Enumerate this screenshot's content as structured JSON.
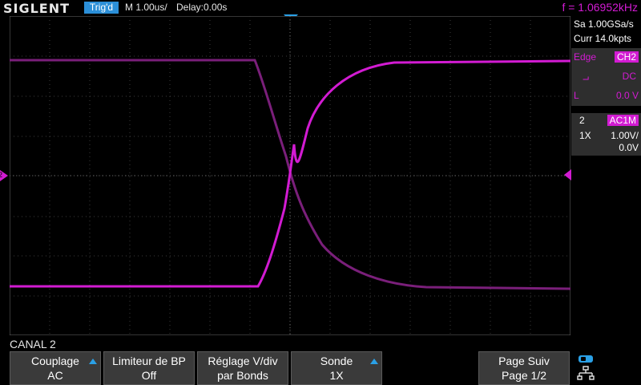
{
  "header": {
    "brand": "SIGLENT",
    "trigger_status": "Trig'd",
    "timebase": "M 1.00us/",
    "delay": "Delay:0.00s",
    "frequency": "f = 1.06952kHz"
  },
  "acquisition": {
    "sample_rate": "Sa 1.00GSa/s",
    "memory_depth": "Curr 14.0kpts"
  },
  "trigger_panel": {
    "type_label": "Edge",
    "source": "CH2",
    "coupling": "DC",
    "level_label": "L",
    "level": "0.0 V"
  },
  "channel_panel": {
    "channel": "2",
    "coupling": "AC1M",
    "probe": "1X",
    "volts_div": "1.00V/",
    "offset": "0.0V"
  },
  "channel_marker": "2",
  "colors": {
    "channel2": "#d21bd2",
    "accent": "#2aa0e6",
    "grid": "#5a5a5a"
  },
  "menu": {
    "title": "CANAL 2",
    "items": [
      {
        "line1": "Couplage",
        "line2": "AC"
      },
      {
        "line1": "Limiteur de BP",
        "line2": "Off"
      },
      {
        "line1": "Réglage V/div",
        "line2": "par Bonds"
      },
      {
        "line1": "Sonde",
        "line2": "1X"
      },
      {
        "line1": "Page Suiv",
        "line2": "Page 1/2"
      }
    ]
  }
}
